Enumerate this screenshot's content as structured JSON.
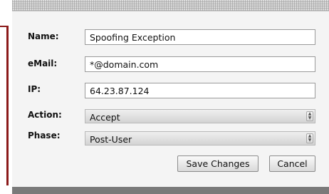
{
  "form": {
    "name_label": "Name:",
    "name_value": "Spoofing Exception",
    "email_label": "eMail:",
    "email_value": "*@domain.com",
    "ip_label": "IP:",
    "ip_value": "64.23.87.124",
    "action_label": "Action:",
    "action_value": "Accept",
    "phase_label": "Phase:",
    "phase_value": "Post-User"
  },
  "buttons": {
    "save": "Save Changes",
    "cancel": "Cancel"
  },
  "icons": {
    "select_arrow": "updown-arrow-icon"
  }
}
